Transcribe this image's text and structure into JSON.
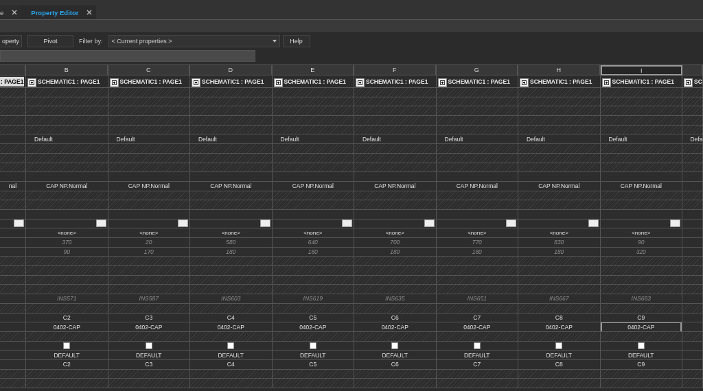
{
  "tabs": [
    {
      "label": "e",
      "selected": false
    },
    {
      "label": "Property Editor",
      "selected": true
    }
  ],
  "toolbar": {
    "buttons": [
      "operty",
      "Pivot"
    ],
    "filter_label": "Filter by:",
    "filter_value": "< Current properties >",
    "help": "Help"
  },
  "columns": [
    {
      "title": ": PAGE1",
      "selected": false,
      "highlighted": true,
      "expander": false
    },
    {
      "letter": "B",
      "title": "SCHEMATIC1 : PAGE1",
      "selected": false,
      "highlighted": false,
      "expander": true
    },
    {
      "letter": "C",
      "title": "SCHEMATIC1 : PAGE1",
      "selected": false,
      "highlighted": false,
      "expander": true
    },
    {
      "letter": "D",
      "title": "SCHEMATIC1 : PAGE1",
      "selected": false,
      "highlighted": false,
      "expander": true
    },
    {
      "letter": "E",
      "title": "SCHEMATIC1 : PAGE1",
      "selected": false,
      "highlighted": false,
      "expander": true
    },
    {
      "letter": "F",
      "title": "SCHEMATIC1 : PAGE1",
      "selected": false,
      "highlighted": false,
      "expander": true
    },
    {
      "letter": "G",
      "title": "SCHEMATIC1 : PAGE1",
      "selected": false,
      "highlighted": false,
      "expander": true
    },
    {
      "letter": "H",
      "title": "SCHEMATIC1 : PAGE1",
      "selected": false,
      "highlighted": false,
      "expander": true
    },
    {
      "letter": "I",
      "title": "SCHEMATIC1 : PAGE1",
      "selected": true,
      "highlighted": false,
      "expander": true
    },
    {
      "title": "SC",
      "selected": false,
      "highlighted": false,
      "expander": true
    }
  ],
  "rows": [
    {
      "kind": "hatched"
    },
    {
      "kind": "hatched"
    },
    {
      "kind": "hatched"
    },
    {
      "kind": "hatched"
    },
    {
      "kind": "hatched"
    },
    {
      "kind": "text-left",
      "cells": [
        null,
        "Default",
        "Default",
        "Default",
        "Default",
        "Default",
        "Default",
        "Default",
        "Default",
        "Defa"
      ]
    },
    {
      "kind": "hatched"
    },
    {
      "kind": "hatched"
    },
    {
      "kind": "hatched"
    },
    {
      "kind": "blank"
    },
    {
      "kind": "text",
      "cells": [
        "nal",
        "CAP NP.Normal",
        "CAP NP.Normal",
        "CAP NP.Normal",
        "CAP NP.Normal",
        "CAP NP.Normal",
        "CAP NP.Normal",
        "CAP NP.Normal",
        "CAP NP.Normal",
        null
      ]
    },
    {
      "kind": "hatched"
    },
    {
      "kind": "hatched"
    },
    {
      "kind": "blank"
    },
    {
      "kind": "button",
      "cells": [
        true,
        true,
        true,
        true,
        true,
        true,
        true,
        true,
        true,
        false
      ]
    },
    {
      "kind": "small",
      "cells": [
        null,
        "<none>",
        "<none>",
        "<none>",
        "<none>",
        "<none>",
        "<none>",
        "<none>",
        "<none>",
        null
      ]
    },
    {
      "kind": "italic",
      "cells": [
        null,
        "370",
        "20",
        "580",
        "640",
        "700",
        "770",
        "830",
        "90",
        null
      ]
    },
    {
      "kind": "italic",
      "cells": [
        null,
        "90",
        "170",
        "180",
        "180",
        "180",
        "180",
        "180",
        "320",
        null
      ]
    },
    {
      "kind": "hatched"
    },
    {
      "kind": "hatched"
    },
    {
      "kind": "hatched"
    },
    {
      "kind": "hatched"
    },
    {
      "kind": "italic",
      "cells": [
        null,
        "INS571",
        "INS587",
        "INS603",
        "INS619",
        "INS635",
        "INS651",
        "INS667",
        "INS683",
        null
      ]
    },
    {
      "kind": "hatched"
    },
    {
      "kind": "text",
      "cells": [
        null,
        "C2",
        "C3",
        "C4",
        "C5",
        "C6",
        "C7",
        "C8",
        "C9",
        null
      ]
    },
    {
      "kind": "edit",
      "cells": [
        null,
        {
          "text": "0402-CAP",
          "selected": false
        },
        {
          "text": "0402-CAP",
          "selected": false
        },
        {
          "text": "0402-CAP",
          "selected": false
        },
        {
          "text": "0402-CAP",
          "selected": false
        },
        {
          "text": "0402-CAP",
          "selected": false
        },
        {
          "text": "0402-CAP",
          "selected": false
        },
        {
          "text": "0402-CAP",
          "selected": false
        },
        {
          "text": "0402-CAP",
          "selected": true
        },
        null
      ]
    },
    {
      "kind": "hatched"
    },
    {
      "kind": "checkbox",
      "cells": [
        null,
        {
          "checked": false
        },
        {
          "checked": false
        },
        {
          "checked": false
        },
        {
          "checked": false
        },
        {
          "checked": false
        },
        {
          "checked": false
        },
        {
          "checked": false
        },
        {
          "checked": false
        },
        null
      ]
    },
    {
      "kind": "text",
      "cells": [
        null,
        "DEFAULT",
        "DEFAULT",
        "DEFAULT",
        "DEFAULT",
        "DEFAULT",
        "DEFAULT",
        "DEFAULT",
        "DEFAULT",
        null
      ]
    },
    {
      "kind": "text",
      "cells": [
        null,
        "C2",
        "C3",
        "C4",
        "C5",
        "C6",
        "C7",
        "C8",
        "C9",
        null
      ]
    },
    {
      "kind": "hatched"
    },
    {
      "kind": "hatched"
    }
  ]
}
